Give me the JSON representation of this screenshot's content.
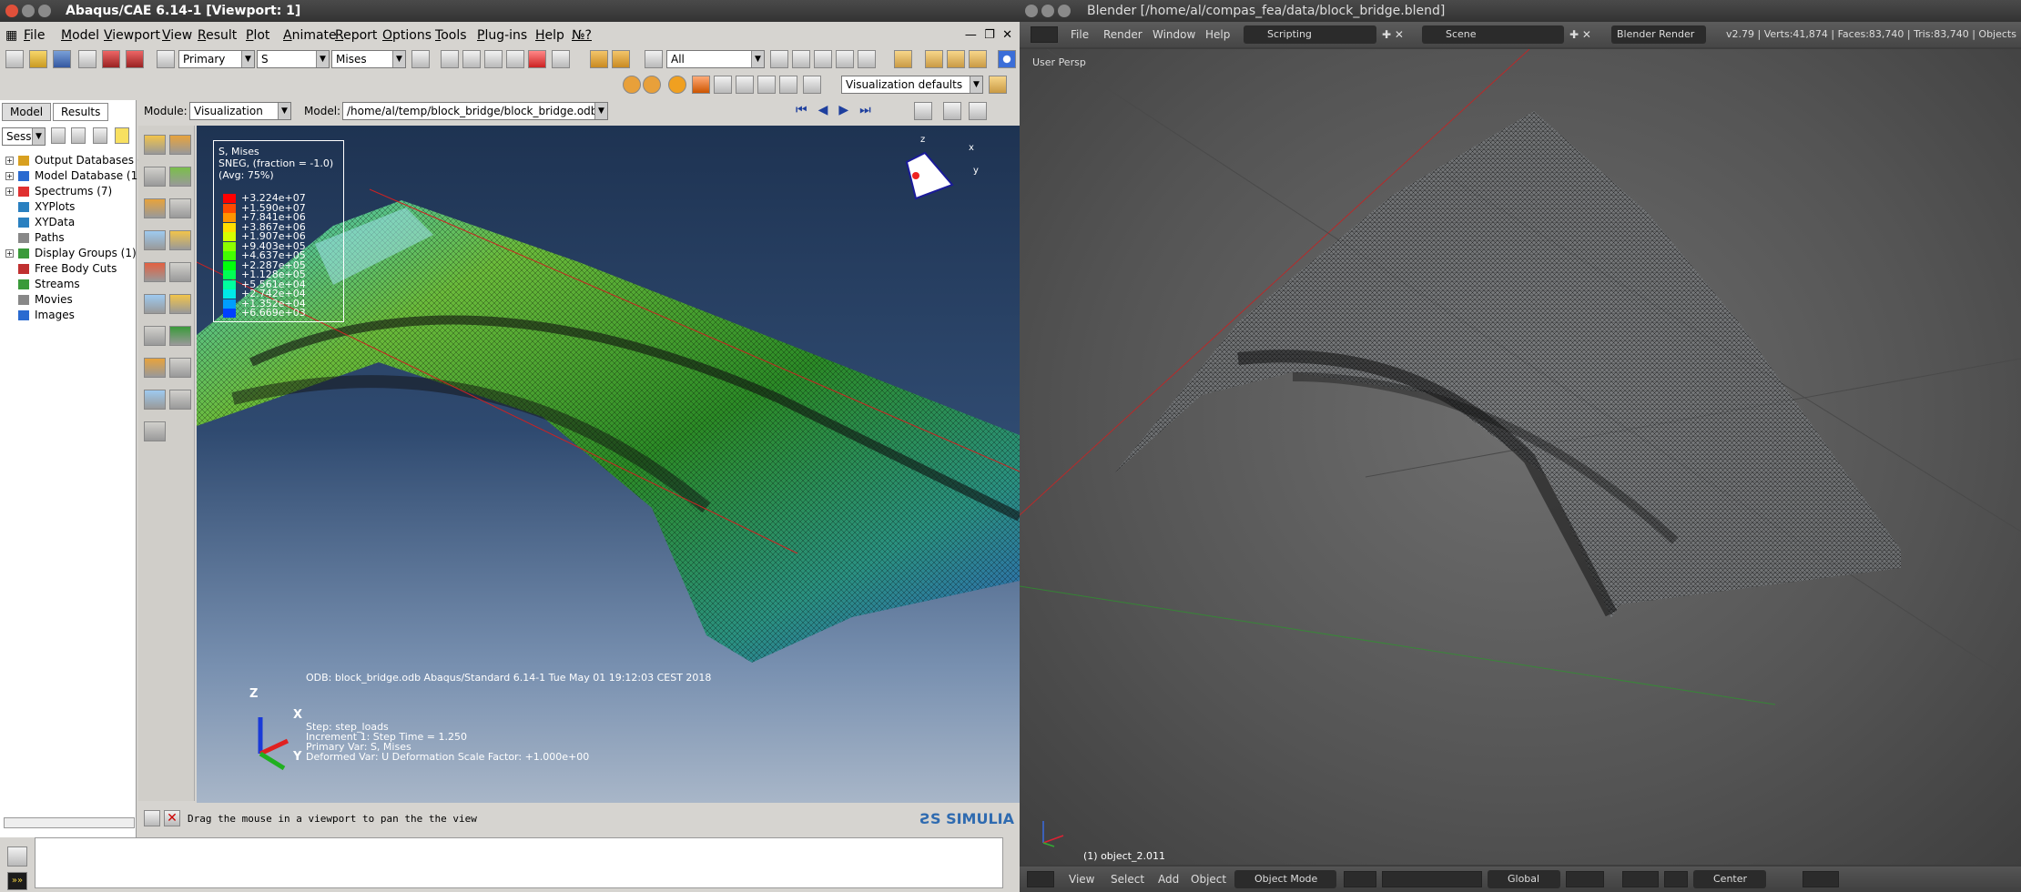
{
  "abaqus": {
    "title": "Abaqus/CAE 6.14-1 [Viewport: 1]",
    "menu": [
      "File",
      "Model",
      "Viewport",
      "View",
      "Result",
      "Plot",
      "Animate",
      "Report",
      "Options",
      "Tools",
      "Plug-ins",
      "Help",
      "№?"
    ],
    "toolbar": {
      "primary_combo": "Primary",
      "s_combo": "S",
      "mises_combo": "Mises",
      "all_combo": "All",
      "viz_defaults": "Visualization defaults"
    },
    "tabs": [
      "Model",
      "Results"
    ],
    "session_combo": "Sessi",
    "module_label": "Module:",
    "module_value": "Visualization",
    "model_label": "Model:",
    "model_path": "/home/al/temp/block_bridge/block_bridge.odb",
    "tree": [
      {
        "label": "Output Databases (",
        "expand": true
      },
      {
        "label": "Model Database (1)",
        "expand": true
      },
      {
        "label": "Spectrums (7)",
        "expand": true
      },
      {
        "label": "XYPlots",
        "expand": false
      },
      {
        "label": "XYData",
        "expand": false
      },
      {
        "label": "Paths",
        "expand": false
      },
      {
        "label": "Display Groups (1)",
        "expand": true
      },
      {
        "label": "Free Body Cuts",
        "expand": false
      },
      {
        "label": "Streams",
        "expand": false
      },
      {
        "label": "Movies",
        "expand": false
      },
      {
        "label": "Images",
        "expand": false
      }
    ],
    "legend": {
      "title1": "S, Mises",
      "title2": "SNEG, (fraction = -1.0)",
      "title3": "(Avg: 75%)",
      "values": [
        "+3.224e+07",
        "+1.590e+07",
        "+7.841e+06",
        "+3.867e+06",
        "+1.907e+06",
        "+9.403e+05",
        "+4.637e+05",
        "+2.287e+05",
        "+1.128e+05",
        "+5.561e+04",
        "+2.742e+04",
        "+1.352e+04",
        "+6.669e+03"
      ],
      "colors": [
        "#ff0000",
        "#ff4a00",
        "#ff9400",
        "#ffde00",
        "#d6ff00",
        "#8cff00",
        "#42ff00",
        "#00ff0a",
        "#00ff54",
        "#00ff9e",
        "#00e8e8",
        "#009eff",
        "#0040ff"
      ]
    },
    "viewport": {
      "odb_line": "ODB: block_bridge.odb    Abaqus/Standard 6.14-1    Tue May 01 19:12:03 CEST 2018",
      "step": "Step: step_loads",
      "increment": "Increment      1: Step Time =     1.250",
      "primary_var": "Primary Var: S, Mises",
      "deformed_var": "Deformed Var: U   Deformation Scale Factor: +1.000e+00",
      "triad": {
        "z": "Z",
        "x": "X",
        "y": "Y"
      }
    },
    "prompt": "Drag the mouse in a viewport to pan the the view",
    "simulia": "SIMULIA"
  },
  "blender": {
    "title": "Blender [/home/al/compas_fea/data/block_bridge.blend]",
    "menu": [
      "File",
      "Render",
      "Window",
      "Help"
    ],
    "layout": "Scripting",
    "scene": "Scene",
    "engine": "Blender Render",
    "stats": "v2.79 | Verts:41,874 | Faces:83,740 | Tris:83,740 | Objects",
    "view_label": "User Persp",
    "object_label": "(1) object_2.011",
    "bottom_menu": [
      "View",
      "Select",
      "Add",
      "Object"
    ],
    "mode": "Object Mode",
    "orientation": "Global",
    "pivot": "Center"
  },
  "colors": {
    "abaqus_bg": "#d6d4d0",
    "viewport_top": "#1e3352",
    "blender_bg": "#545454",
    "accent_red": "#d22"
  }
}
